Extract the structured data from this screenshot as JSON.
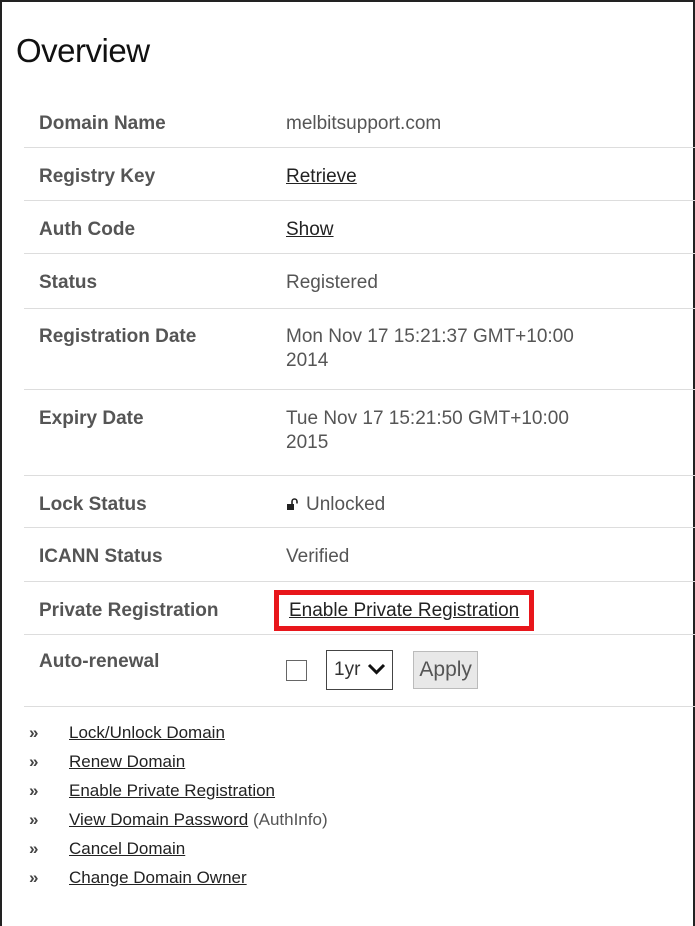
{
  "title": "Overview",
  "rows": {
    "domain_name": {
      "label": "Domain Name",
      "value": "melbitsupport.com"
    },
    "registry_key": {
      "label": "Registry Key",
      "link": "Retrieve"
    },
    "auth_code": {
      "label": "Auth Code",
      "link": "Show"
    },
    "status": {
      "label": "Status",
      "value": "Registered"
    },
    "registration_date": {
      "label": "Registration Date",
      "value_line1": "Mon Nov 17 15:21:37 GMT+10:00",
      "value_line2": "2014"
    },
    "expiry_date": {
      "label": "Expiry Date",
      "value_line1": "Tue Nov 17 15:21:50 GMT+10:00",
      "value_line2": "2015"
    },
    "lock_status": {
      "label": "Lock Status",
      "value": "Unlocked",
      "icon": "unlocked-padlock-icon"
    },
    "icann_status": {
      "label": "ICANN Status",
      "value": "Verified"
    },
    "private_registration": {
      "label": "Private Registration",
      "link": "Enable Private Registration",
      "highlight_color": "#e8161b"
    },
    "auto_renewal": {
      "label": "Auto-renewal",
      "checked": false,
      "period_selected": "1yr",
      "apply_label": "Apply"
    }
  },
  "links": [
    {
      "bullet": "»",
      "label": "Lock/Unlock Domain"
    },
    {
      "bullet": "»",
      "label": "Renew Domain"
    },
    {
      "bullet": "»",
      "label": "Enable Private Registration"
    },
    {
      "bullet": "»",
      "label": "View Domain Password",
      "suffix": "(AuthInfo)"
    },
    {
      "bullet": "»",
      "label": "Cancel Domain"
    },
    {
      "bullet": "»",
      "label": "Change Domain Owner"
    }
  ]
}
